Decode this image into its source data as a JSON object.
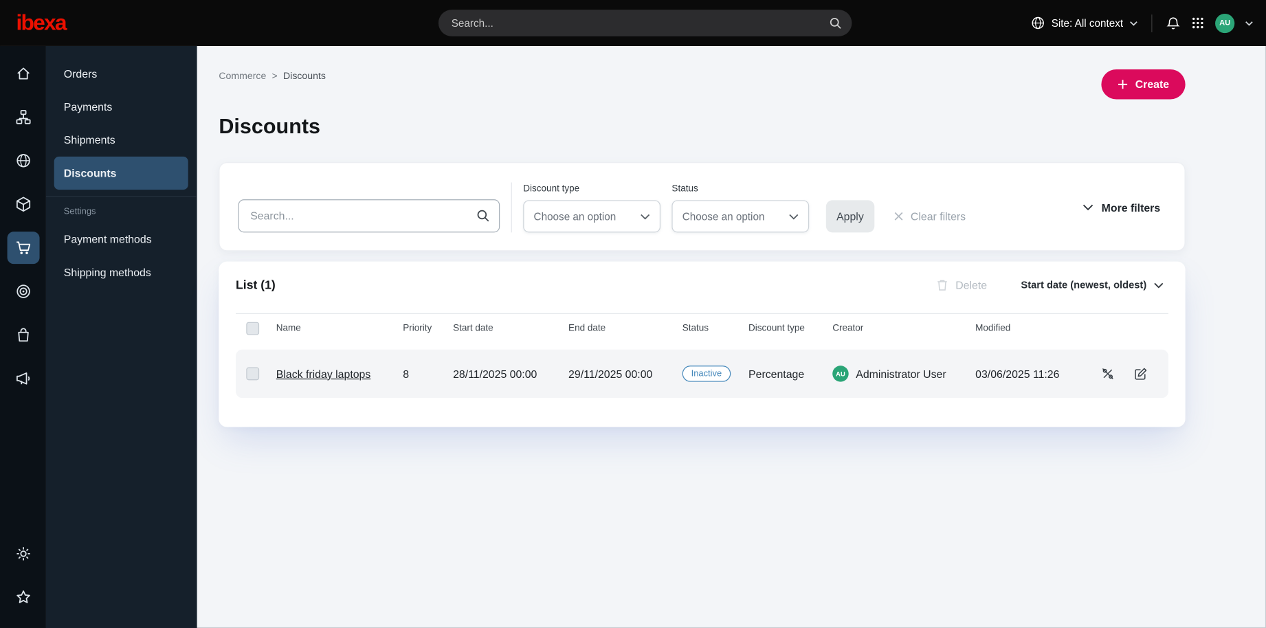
{
  "colors": {
    "accent": "#db0a5c",
    "logo": "#eb1000",
    "active_nav": "#2e506f",
    "badge": "#4387ba",
    "avatar": "#2ba577"
  },
  "topbar": {
    "logo": "ibexa",
    "search_placeholder": "Search...",
    "site_context": "Site: All context",
    "user_initials": "AU",
    "icons": [
      "search-icon",
      "globe-icon",
      "chevron-down-icon",
      "notifications-bell-icon",
      "apps-grid-icon"
    ]
  },
  "sidebar": {
    "rail_icons": [
      "dashboard-icon",
      "content-tree-icon",
      "site-globe-icon",
      "product-catalog-icon",
      "commerce-cart-icon",
      "personalization-target-icon",
      "store-bag-icon",
      "promotions-megaphone-icon",
      "settings-gear-icon",
      "bookmarks-star-icon"
    ],
    "active_rail_icon": "commerce-cart-icon",
    "menu_items": [
      {
        "label": "Orders",
        "active": false
      },
      {
        "label": "Payments",
        "active": false
      },
      {
        "label": "Shipments",
        "active": false
      },
      {
        "label": "Discounts",
        "active": true
      }
    ],
    "settings_label": "Settings",
    "settings_items": [
      {
        "label": "Payment methods"
      },
      {
        "label": "Shipping methods"
      }
    ]
  },
  "breadcrumb": {
    "items": [
      "Commerce",
      "Discounts"
    ],
    "separator": ">"
  },
  "page": {
    "title": "Discounts",
    "create_label": "Create"
  },
  "filters": {
    "search_placeholder": "Search...",
    "discount_type_label": "Discount type",
    "discount_type_value": "Choose an option",
    "status_label": "Status",
    "status_value": "Choose an option",
    "apply_label": "Apply",
    "clear_label": "Clear filters",
    "more_label": "More filters"
  },
  "list": {
    "title": "List (1)",
    "delete_label": "Delete",
    "sort_label": "Start date (newest, oldest)",
    "columns": [
      "Name",
      "Priority",
      "Start date",
      "End date",
      "Status",
      "Discount type",
      "Creator",
      "Modified"
    ],
    "rows": [
      {
        "name": "Black friday laptops",
        "priority": "8",
        "start_date": "28/11/2025 00:00",
        "end_date": "29/11/2025 00:00",
        "status": "Inactive",
        "discount_type": "Percentage",
        "creator_initials": "AU",
        "creator": "Administrator User",
        "modified": "03/06/2025 11:26"
      }
    ],
    "row_actions": [
      "deactivate-icon",
      "edit-icon"
    ]
  }
}
